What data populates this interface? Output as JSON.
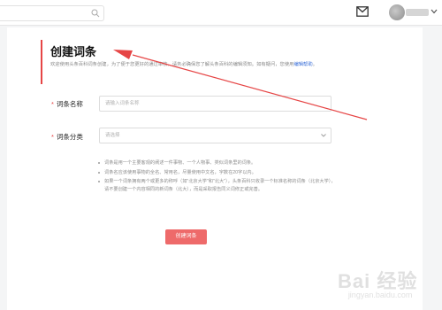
{
  "header": {
    "search": {
      "placeholder": ""
    },
    "icons": {
      "search": "search-icon",
      "mail": "mail-icon",
      "chevron": "chevron-down-icon"
    }
  },
  "form": {
    "title": "创建词条",
    "intro_text": "欢迎使用头条百科词条创建，为了便于您更好的通过审核，请务必确保您了解头条百科的编辑须知。如有疑问，您使用",
    "intro_link": "编辑帮助",
    "intro_tail": "。",
    "name": {
      "label": "词条名称",
      "placeholder": "请输入词条名称"
    },
    "category": {
      "label": "词条分类",
      "placeholder": "请选择"
    },
    "tips": [
      "词条是用一个主要客观的阐述一件事物、一个人物事、类似词条里的词条。",
      "词条名应该使用事物的全名、常用名，尽量使用中文名，字数在20字以内。",
      "如果一个词条拥有两个或更多的称呼（如\"北京大学\"和\"北大\"），头条百科只收录一个标准名称的词条（北京大学），请不要创建一个内容相同的新词条（北大），而是采取报告同义词修正或完善。"
    ],
    "submit_label": "创建词条"
  },
  "watermark": {
    "main": "Bai 经验",
    "sub": "jingyan.baidu.com"
  },
  "colors": {
    "accent": "#e64545",
    "button": "#ee6a6a",
    "link": "#3a6fd8"
  }
}
